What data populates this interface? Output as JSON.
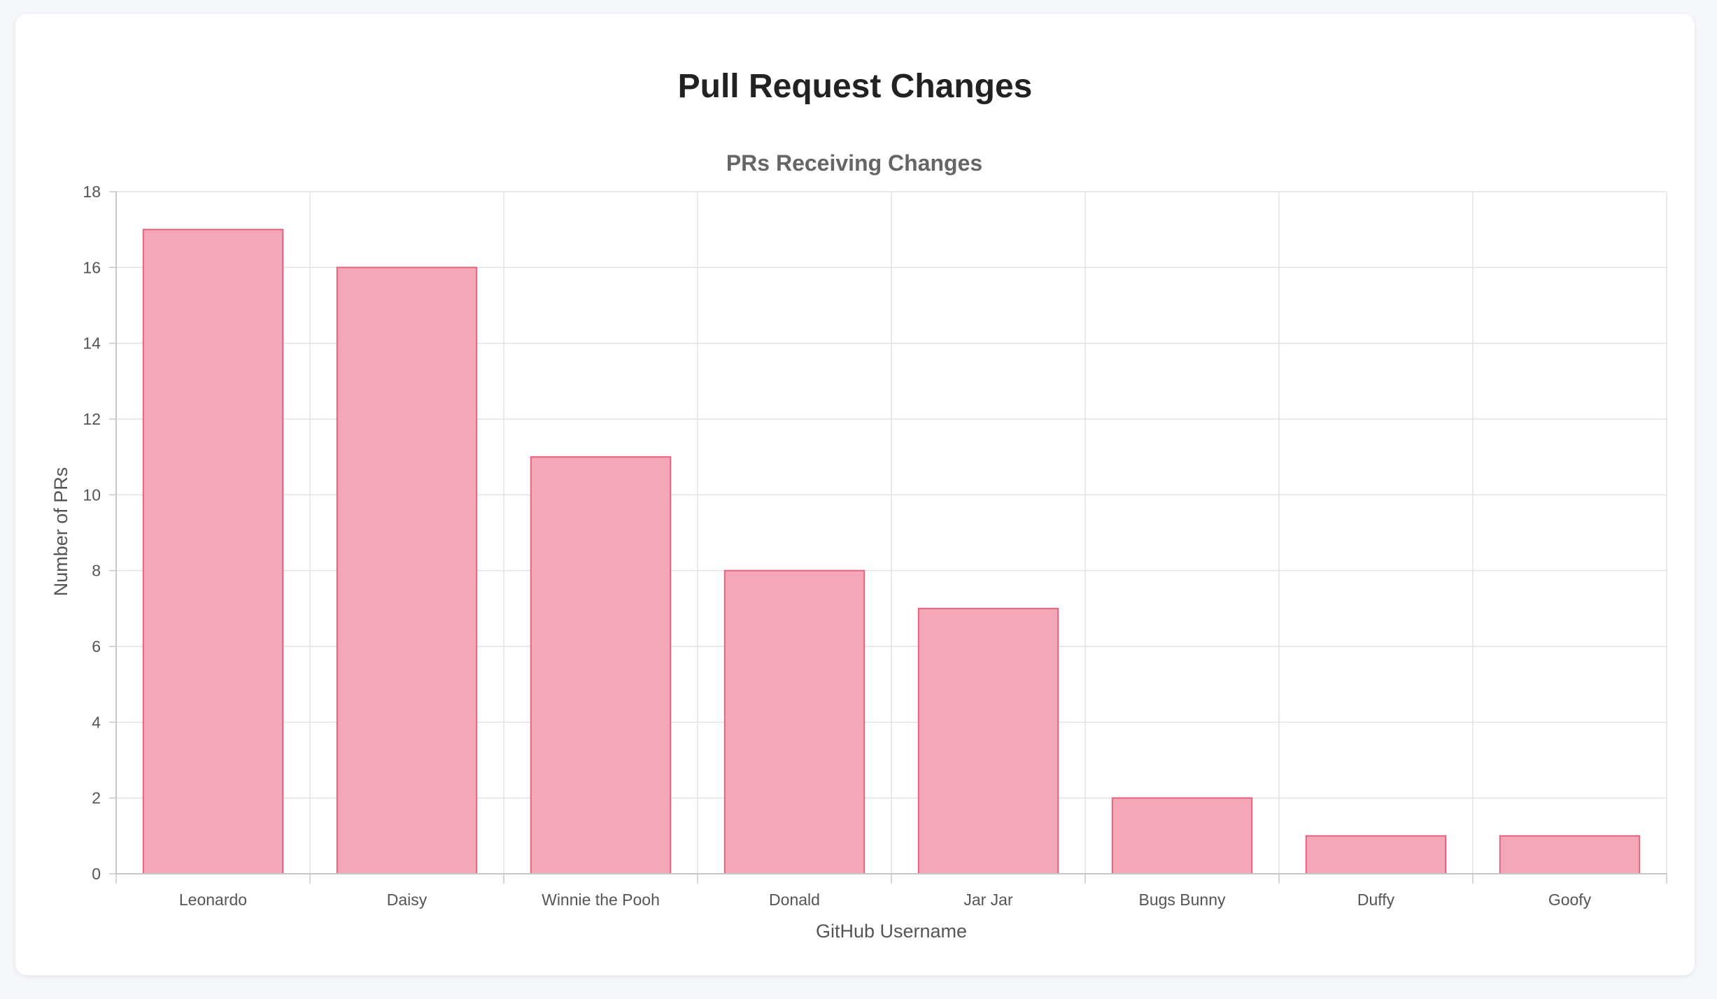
{
  "page": {
    "title": "Pull Request Changes"
  },
  "chart_data": {
    "type": "bar",
    "title": "PRs Receiving Changes",
    "xlabel": "GitHub Username",
    "ylabel": "Number of PRs",
    "categories": [
      "Leonardo",
      "Daisy",
      "Winnie the Pooh",
      "Donald",
      "Jar Jar",
      "Bugs Bunny",
      "Duffy",
      "Goofy"
    ],
    "series": [
      {
        "values": [
          17,
          16,
          11,
          8,
          7,
          2,
          1,
          1
        ]
      }
    ],
    "ylim": [
      0,
      18
    ],
    "yticks": [
      "0",
      "2",
      "4",
      "6",
      "8",
      "10",
      "12",
      "14",
      "16",
      "18"
    ],
    "grid": true,
    "legend": "none",
    "colors": {
      "bar_fill": "#f4a7b6",
      "bar_border": "#e8637e",
      "grid": "#e3e3e3",
      "axis": "#c8c8c8",
      "text": "#555555",
      "title": "#666666"
    }
  }
}
